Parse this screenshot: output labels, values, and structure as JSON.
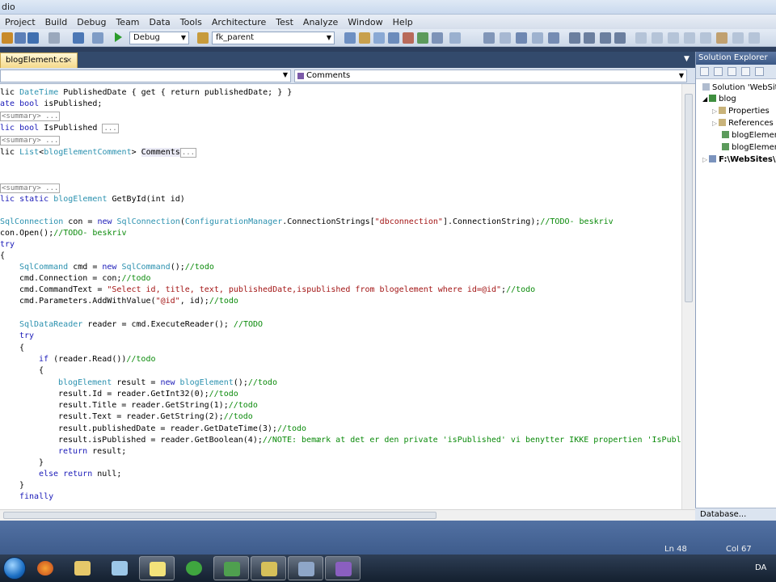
{
  "window": {
    "title_fragment": "dio"
  },
  "menu": [
    "Project",
    "Build",
    "Debug",
    "Team",
    "Data",
    "Tools",
    "Architecture",
    "Test",
    "Analyze",
    "Window",
    "Help"
  ],
  "toolbar": {
    "config": "Debug",
    "find": "fk_parent"
  },
  "tab": {
    "label": "blogElement.cs",
    "close": "×"
  },
  "nav": {
    "members": "Comments"
  },
  "code": {
    "l1a": "lic ",
    "l1b": "DateTime",
    "l1c": " PublishedDate { get { return publishedDate; } }",
    "l2a": "ate bool",
    "l2b": " isPublished;",
    "summary": "<summary> ...",
    "l4a": "lic bool",
    "l4b": " IsPublished ",
    "dots": "...",
    "l6a": "lic ",
    "l6b": "List",
    "l6c": "<",
    "l6d": "blogElementComment",
    "l6e": "> ",
    "l6f": "Comments",
    "l8a": "lic static ",
    "l8b": "blogElement",
    "l8c": " GetById(int id)",
    "c1": "SqlConnection",
    "c1b": " con = ",
    "c1c": "new ",
    "c1d": "SqlConnection",
    "c1e": "(",
    "c1f": "ConfigurationManager",
    "c1g": ".ConnectionStrings[",
    "c1h": "\"dbconnection\"",
    "c1i": "].ConnectionString);",
    "c1j": "//TODO- beskriv",
    "c2a": "con.Open();",
    "c2b": "//TODO- beskriv",
    "c3": "try",
    "brace_open": "{",
    "brace_close": "}",
    "c4a": "SqlCommand",
    "c4b": " cmd = ",
    "c4c": "new ",
    "c4d": "SqlCommand",
    "c4e": "();",
    "c4f": "//todo",
    "c5a": "cmd.Connection = con;",
    "c5b": "//todo",
    "c6a": "cmd.CommandText = ",
    "c6b": "\"Select id, title, text, publishedDate,ispublished from blogelement where id=@id\"",
    "c6c": ";",
    "c6d": "//todo",
    "c7a": "cmd.Parameters.AddWithValue(",
    "c7b": "\"@id\"",
    "c7c": ", id);",
    "c7d": "//todo",
    "c8a": "SqlDataReader",
    "c8b": " reader = cmd.ExecuteReader(); ",
    "c8c": "//TODO",
    "c9a": "if",
    "c9b": " (reader.Read())",
    "c9c": "//todo",
    "c10a": "blogElement",
    "c10b": " result = ",
    "c10c": "new ",
    "c10d": "blogElement",
    "c10e": "();",
    "c10f": "//todo",
    "c11a": "result.Id = reader.GetInt32(0);",
    "c11b": "//todo",
    "c12a": "result.Title = reader.GetString(1);",
    "c12b": "//todo",
    "c13a": "result.Text = reader.GetString(2);",
    "c13b": "//todo",
    "c14a": "result.publishedDate = reader.GetDateTime(3);",
    "c14b": "//todo",
    "c15a": "result.isPublished = reader.GetBoolean(4);",
    "c15b": "//NOTE: bemærk at det er den private 'isPublished' vi benytter IKKE propertien 'IsPubli",
    "c16a": "return",
    "c16b": " result;",
    "c17a": "else return",
    "c17b": " null;",
    "c18": "finally"
  },
  "solution": {
    "title": "Solution Explorer",
    "items": [
      "Solution 'WebSites'",
      "blog",
      "Properties",
      "References",
      "blogElement",
      "blogElement",
      "F:\\WebSites\\W"
    ],
    "footer": "Database..."
  },
  "status": {
    "line": "Ln 48",
    "col": "Col 67"
  },
  "taskbar": {
    "lang": "DA"
  }
}
